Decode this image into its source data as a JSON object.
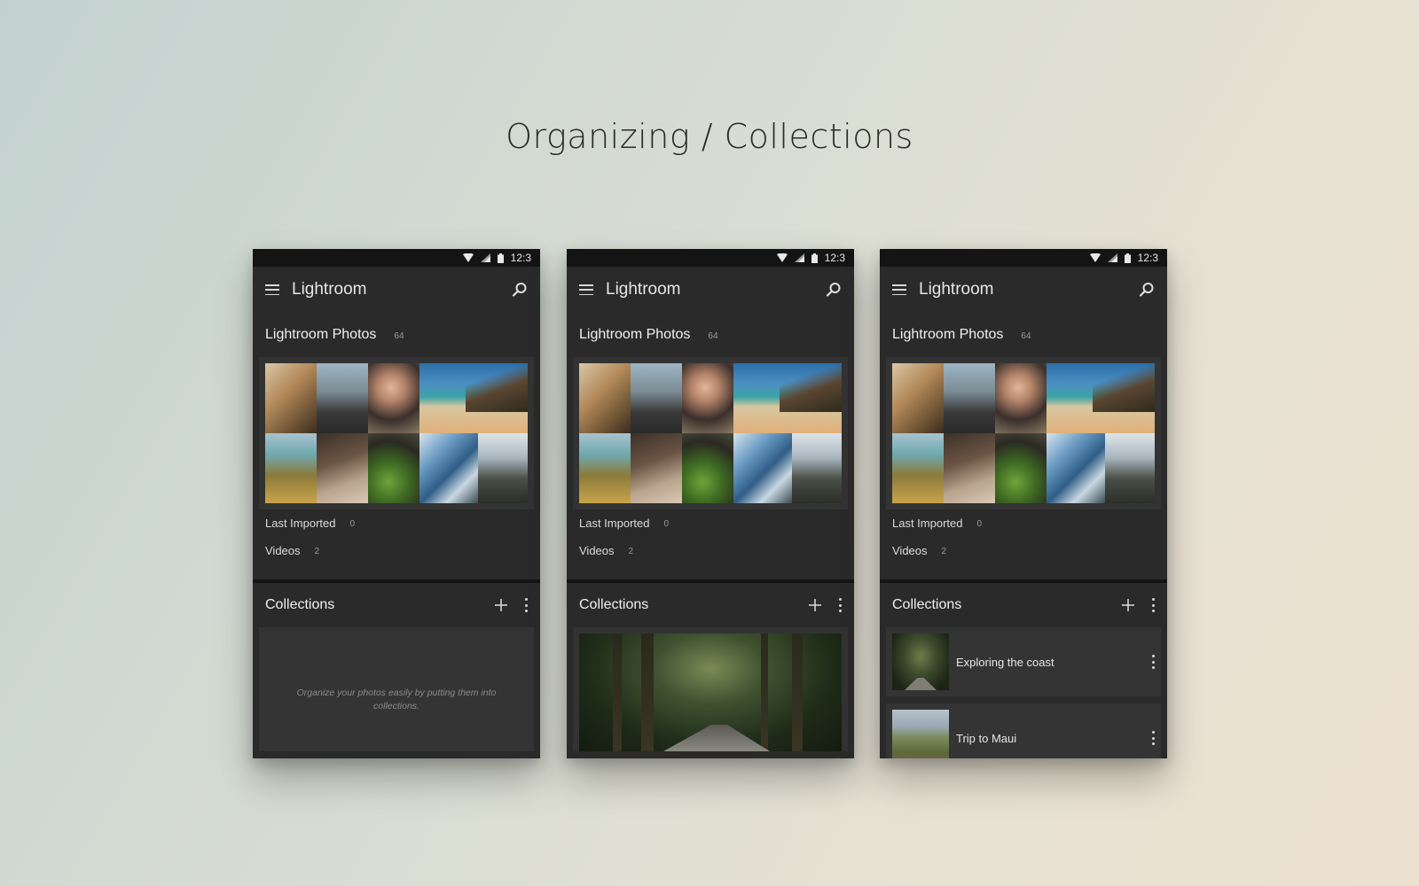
{
  "page": {
    "title": "Organizing / Collections"
  },
  "status": {
    "time": "12:3"
  },
  "app": {
    "title": "Lightroom"
  },
  "library": {
    "title": "Lightroom Photos",
    "count": "64",
    "last_imported_label": "Last Imported",
    "last_imported_count": "0",
    "videos_label": "Videos",
    "videos_count": "2"
  },
  "collections": {
    "title": "Collections",
    "empty_text": "Organize your photos easily by putting them into collections.",
    "items": [
      {
        "name": "Exploring the coast"
      },
      {
        "name": "Trip to Maui"
      }
    ]
  },
  "icons": {
    "menu": "hamburger-menu-icon",
    "search": "search-icon",
    "add": "plus-icon",
    "more": "kebab-menu-icon",
    "wifi": "wifi-icon",
    "signal": "cell-signal-icon",
    "battery": "battery-icon"
  },
  "colors": {
    "app_bg": "#2a2a2a",
    "status_bg": "#141414",
    "card_bg": "#343434",
    "text_primary": "#f0f0f0",
    "text_secondary": "#9a9a9a"
  }
}
